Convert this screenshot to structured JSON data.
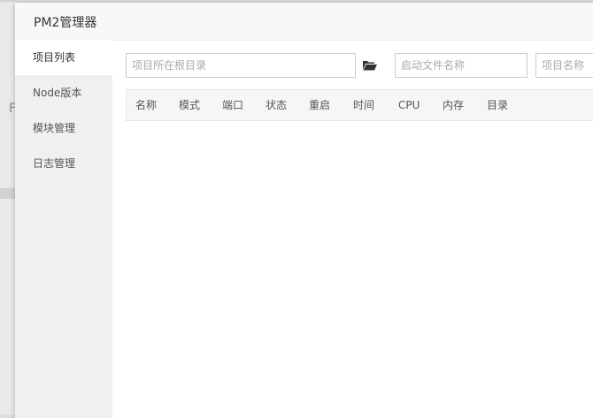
{
  "background": {
    "edge_letter": "F"
  },
  "modal": {
    "title": "PM2管理器"
  },
  "sidebar": {
    "items": [
      {
        "label": "项目列表",
        "active": true
      },
      {
        "label": "Node版本",
        "active": false
      },
      {
        "label": "模块管理",
        "active": false
      },
      {
        "label": "日志管理",
        "active": false
      }
    ]
  },
  "form": {
    "project_path_placeholder": "项目所在根目录",
    "start_file_placeholder": "启动文件名称",
    "project_name_placeholder": "项目名称"
  },
  "table": {
    "headers": [
      "名称",
      "模式",
      "端口",
      "状态",
      "重启",
      "时间",
      "CPU",
      "内存",
      "目录"
    ]
  }
}
